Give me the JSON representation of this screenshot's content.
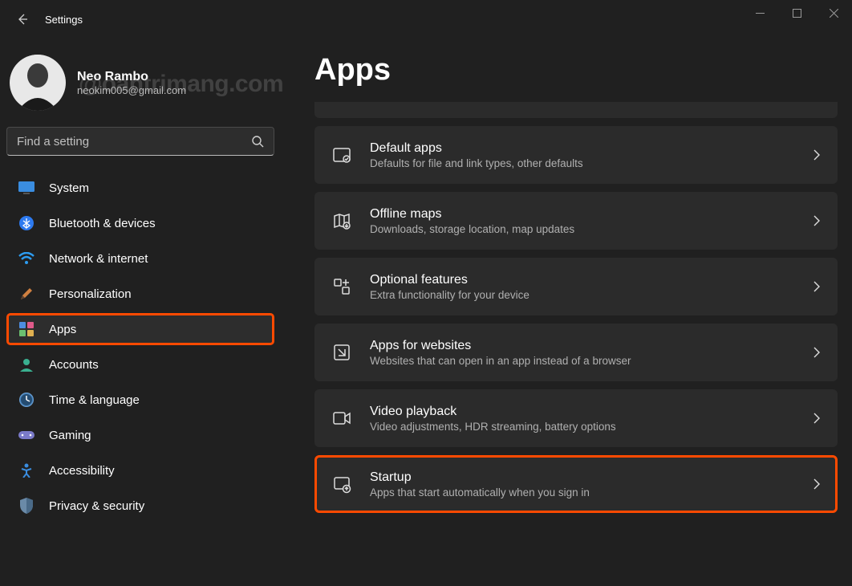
{
  "window": {
    "title": "Settings"
  },
  "profile": {
    "name": "Neo Rambo",
    "email": "neokim005@gmail.com",
    "watermark": "@oantrimang.com"
  },
  "search": {
    "placeholder": "Find a setting"
  },
  "nav": {
    "items": [
      {
        "label": "System"
      },
      {
        "label": "Bluetooth & devices"
      },
      {
        "label": "Network & internet"
      },
      {
        "label": "Personalization"
      },
      {
        "label": "Apps"
      },
      {
        "label": "Accounts"
      },
      {
        "label": "Time & language"
      },
      {
        "label": "Gaming"
      },
      {
        "label": "Accessibility"
      },
      {
        "label": "Privacy & security"
      }
    ]
  },
  "page": {
    "title": "Apps"
  },
  "cards": [
    {
      "title": "Default apps",
      "sub": "Defaults for file and link types, other defaults"
    },
    {
      "title": "Offline maps",
      "sub": "Downloads, storage location, map updates"
    },
    {
      "title": "Optional features",
      "sub": "Extra functionality for your device"
    },
    {
      "title": "Apps for websites",
      "sub": "Websites that can open in an app instead of a browser"
    },
    {
      "title": "Video playback",
      "sub": "Video adjustments, HDR streaming, battery options"
    },
    {
      "title": "Startup",
      "sub": "Apps that start automatically when you sign in"
    }
  ]
}
